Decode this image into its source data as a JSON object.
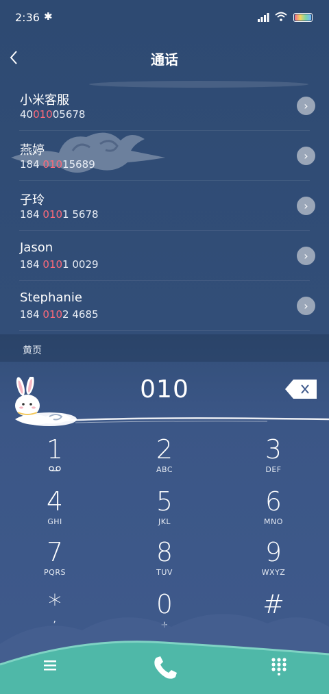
{
  "status": {
    "time": "2:36",
    "icons": [
      "bluetooth-icon",
      "signal-icon",
      "wifi-icon",
      "battery-icon"
    ]
  },
  "header": {
    "title": "通话",
    "back_icon": "chevron-left-icon"
  },
  "contacts": [
    {
      "name": "小米客服",
      "num_pre": "40",
      "num_hl": "010",
      "num_post": "05678"
    },
    {
      "name": "燕婷",
      "num_pre": "184 ",
      "num_hl": "010",
      "num_post": "15689"
    },
    {
      "name": "子玲",
      "num_pre": "184 ",
      "num_hl": "010",
      "num_post": "1 5678"
    },
    {
      "name": "Jason",
      "num_pre": "184 ",
      "num_hl": "010",
      "num_post": "1 0029"
    },
    {
      "name": "Stephanie",
      "num_pre": "184 ",
      "num_hl": "010",
      "num_post": "2 4685"
    }
  ],
  "yellow_pages": {
    "label": "黄页"
  },
  "dialer": {
    "number": "010"
  },
  "keys": [
    {
      "digit": "1",
      "letters": ""
    },
    {
      "digit": "2",
      "letters": "ABC"
    },
    {
      "digit": "3",
      "letters": "DEF"
    },
    {
      "digit": "4",
      "letters": "GHI"
    },
    {
      "digit": "5",
      "letters": "JKL"
    },
    {
      "digit": "6",
      "letters": "MNO"
    },
    {
      "digit": "7",
      "letters": "PQRS"
    },
    {
      "digit": "8",
      "letters": "TUV"
    },
    {
      "digit": "9",
      "letters": "WXYZ"
    },
    {
      "digit": "*",
      "letters": ","
    },
    {
      "digit": "0",
      "letters": "+"
    },
    {
      "digit": "#",
      "letters": ""
    }
  ],
  "colors": {
    "highlight": "#ff6a7a",
    "call": "#ffffff",
    "hill": "#4fb8a8"
  }
}
